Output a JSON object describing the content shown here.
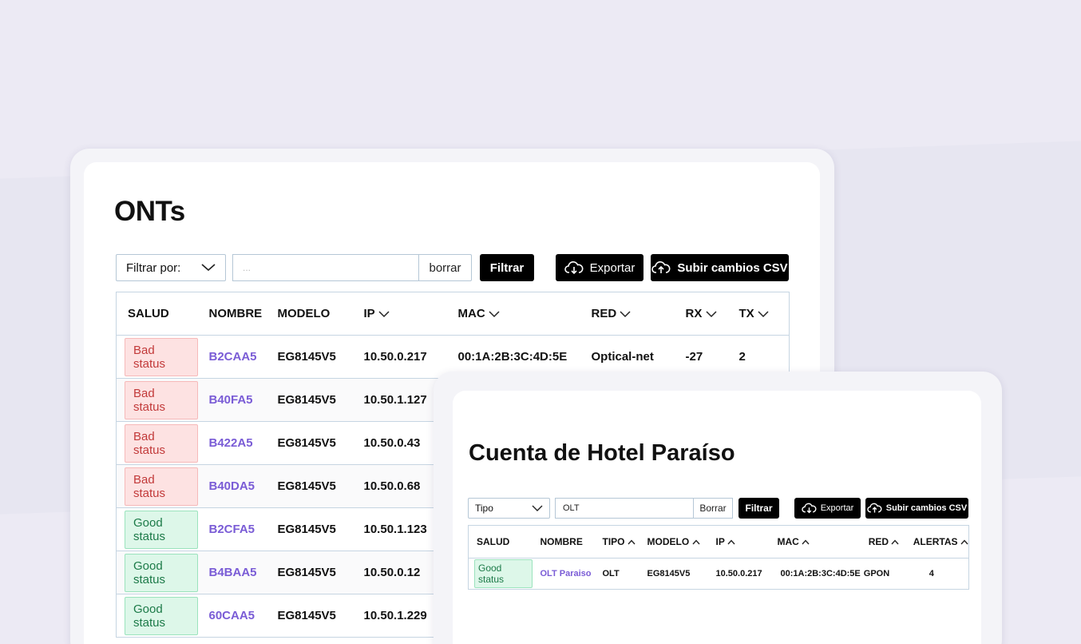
{
  "onts": {
    "title": "ONTs",
    "filter_select": "Filtrar por:",
    "filter_placeholder": "...",
    "clear_button": "borrar",
    "filter_button": "Filtrar",
    "export_button": "Exportar",
    "upload_button": "Subir cambios CSV",
    "columns": [
      "SALUD",
      "NOMBRE",
      "MODELO",
      "IP",
      "MAC",
      "RED",
      "RX",
      "TX"
    ],
    "rows": [
      {
        "salud": "Bad status",
        "status": "bad",
        "nombre": "B2CAA5",
        "modelo": "EG8145V5",
        "ip": "10.50.0.217",
        "mac": "00:1A:2B:3C:4D:5E",
        "red": "Optical-net",
        "rx": "-27",
        "tx": "2"
      },
      {
        "salud": "Bad status",
        "status": "bad",
        "nombre": "B40FA5",
        "modelo": "EG8145V5",
        "ip": "10.50.1.127",
        "mac": "",
        "red": "",
        "rx": "",
        "tx": ""
      },
      {
        "salud": "Bad status",
        "status": "bad",
        "nombre": "B422A5",
        "modelo": "EG8145V5",
        "ip": "10.50.0.43",
        "mac": "",
        "red": "",
        "rx": "",
        "tx": ""
      },
      {
        "salud": "Bad status",
        "status": "bad",
        "nombre": "B40DA5",
        "modelo": "EG8145V5",
        "ip": "10.50.0.68",
        "mac": "",
        "red": "",
        "rx": "",
        "tx": ""
      },
      {
        "salud": "Good status",
        "status": "good",
        "nombre": "B2CFA5",
        "modelo": "EG8145V5",
        "ip": "10.50.1.123",
        "mac": "",
        "red": "",
        "rx": "",
        "tx": ""
      },
      {
        "salud": "Good status",
        "status": "good",
        "nombre": "B4BAA5",
        "modelo": "EG8145V5",
        "ip": "10.50.0.12",
        "mac": "",
        "red": "",
        "rx": "",
        "tx": ""
      },
      {
        "salud": "Good status",
        "status": "good",
        "nombre": "60CAA5",
        "modelo": "EG8145V5",
        "ip": "10.50.1.229",
        "mac": "",
        "red": "",
        "rx": "",
        "tx": ""
      }
    ]
  },
  "hotel": {
    "title": "Cuenta de Hotel Paraíso",
    "filter_select": "Tipo",
    "filter_value": "OLT",
    "clear_button": "Borrar",
    "filter_button": "Filtrar",
    "export_button": "Exportar",
    "upload_button": "Subir cambios CSV",
    "columns": [
      "SALUD",
      "NOMBRE",
      "TIPO",
      "MODELO",
      "IP",
      "MAC",
      "RED",
      "ALERTAS"
    ],
    "rows": [
      {
        "salud": "Good status",
        "status": "good",
        "nombre": "OLT Paraiso",
        "tipo": "OLT",
        "modelo": "EG8145V5",
        "ip": "10.50.0.217",
        "mac": "00:1A:2B:3C:4D:5E",
        "red": "GPON",
        "alertas": "4"
      }
    ]
  },
  "colors": {
    "accent_link": "#7a5cd6",
    "bad_text": "#c23a3a",
    "good_text": "#1c7a48",
    "button_bg": "#000000"
  }
}
